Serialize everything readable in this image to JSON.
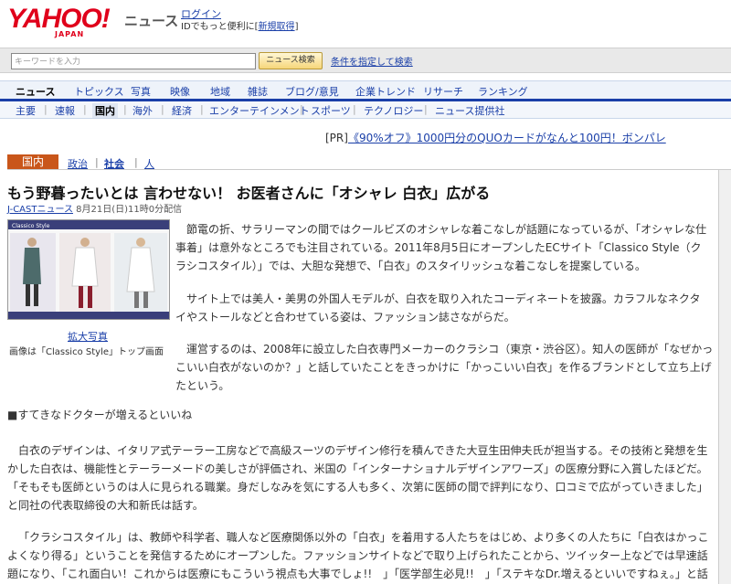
{
  "header": {
    "logo_text": "YAHOO!",
    "logo_sub": "JAPAN",
    "section_name": "ニュース",
    "login_label": "ログイン",
    "login_desc_prefix": "IDでもっと便利に[",
    "signup_label": "新規取得",
    "login_desc_suffix": "]"
  },
  "search": {
    "placeholder": "キーワードを入力",
    "button_label": "ニュース検索",
    "advanced_label": "条件を指定して検索"
  },
  "nav_main": [
    "ニュース",
    "トピックス",
    "写真",
    "映像",
    "地域",
    "雑誌",
    "ブログ/意見",
    "企業トレンド",
    "リサーチ",
    "ランキング"
  ],
  "nav_sub": [
    "主要",
    "速報",
    "国内",
    "海外",
    "経済",
    "エンターテインメント",
    "スポーツ",
    "テクノロジー",
    "ニュース提供社"
  ],
  "pr": {
    "prefix": "[PR]",
    "text": "《90%オフ》1000円分のQUOカードがなんと100円！ボンパレ"
  },
  "category": {
    "current": "国内",
    "items": [
      "政治",
      "社会",
      "人"
    ]
  },
  "article": {
    "headline": "もう野暮ったいとは 言わせない！ お医者さんに「オシャレ 白衣」広がる",
    "source": "J-CASTニュース",
    "date": "8月21日(日)11時0分配信",
    "photo_title": "Classico Style",
    "enlarge_label": "拡大写真",
    "caption": "画像は「Classico Style」トップ画面",
    "paragraphs": [
      "節電の折、サラリーマンの間ではクールビズのオシャレな着こなしが話題になっているが、「オシャレな仕事着」は意外なところでも注目されている。2011年8月5日にオープンしたECサイト「Classico Style（クラシコスタイル）」では、大胆な発想で、「白衣」のスタイリッシュな着こなしを提案している。",
      "サイト上では美人・美男の外国人モデルが、白衣を取り入れたコーディネートを披露。カラフルなネクタイやストールなどと合わせている姿は、ファッション誌さながらだ。",
      "運営するのは、2008年に設立した白衣専門メーカーのクラシコ（東京・渋谷区）。知人の医師が「なぜかっこいい白衣がないのか？」と話していたことをきっかけに「かっこいい白衣」を作るブランドとして立ち上げたという。",
      "■すてきなドクターが増えるといいね",
      "白衣のデザインは、イタリア式テーラー工房などで高級スーツのデザイン修行を積んできた大豆生田伸夫氏が担当する。その技術と発想を生かした白衣は、機能性とテーラーメードの美しさが評価され、米国の「インターナショナルデザインアワーズ」の医療分野に入賞したほどだ。「そもそも医師というのは人に見られる職業。身だしなみを気にする人も多く、次第に医師の間で評判になり、口コミで広がっていきました」と同社の代表取締役の大和新氏は話す。",
      "「クラシコスタイル」は、教師や科学者、職人など医療関係以外の「白衣」を着用する人たちをはじめ、より多くの人たちに「白衣はかっこよくなり得る」ということを発信するためにオープンした。ファッションサイトなどで取り上げられたことから、ツイッター上などでは早速話題になり、「これ面白い！これからは医療にもこういう視点も大事でしょ!!　」「医学部生必見!!　」「ステキなDr.増えるといいですねぇ。」と話題になっ"
    ]
  },
  "colors": {
    "logo_red": "#e0001b",
    "link_blue": "#1a3fa8",
    "category_orange": "#c9561a"
  }
}
